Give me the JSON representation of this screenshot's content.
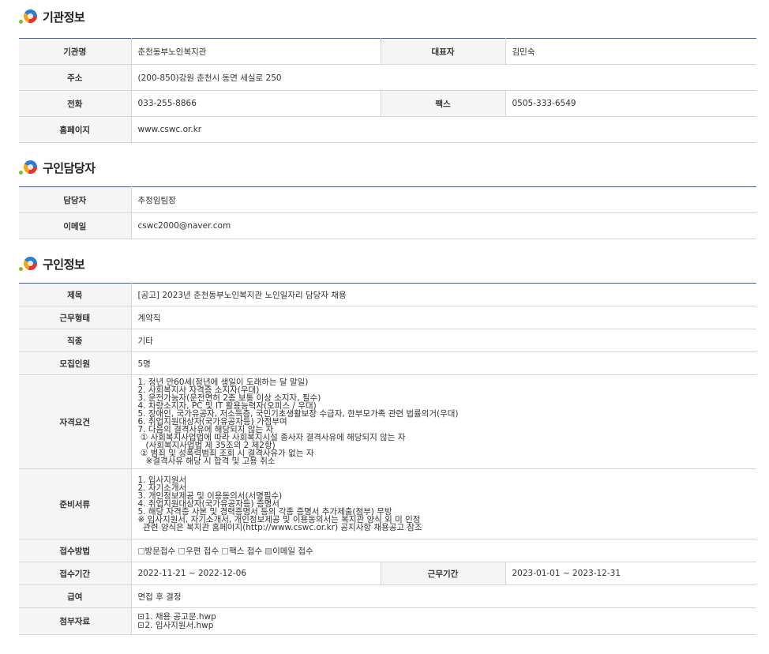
{
  "sections": {
    "agency": {
      "title": "기관정보"
    },
    "manager": {
      "title": "구인담당자"
    },
    "job": {
      "title": "구인정보"
    }
  },
  "agency": {
    "name_label": "기관명",
    "name": "춘천동부노인복지관",
    "rep_label": "대표자",
    "rep": "김민숙",
    "addr_label": "주소",
    "addr": "(200-850)강원 춘천시 동면 세실로 250",
    "phone_label": "전화",
    "phone": "033-255-8866",
    "fax_label": "팩스",
    "fax": "0505-333-6549",
    "web_label": "홈페이지",
    "web": "www.cswc.or.kr"
  },
  "manager": {
    "person_label": "담당자",
    "person": "추정임팀장",
    "email_label": "이메일",
    "email": "cswc2000@naver.com"
  },
  "job": {
    "title_label": "제목",
    "title": "[공고] 2023년 춘천동부노인복지관 노인일자리 담당자 채용",
    "type_label": "근무형태",
    "type": "계약직",
    "category_label": "직종",
    "category": "기타",
    "count_label": "모집인원",
    "count": "5명",
    "qual_label": "자격요건",
    "qualifications": "1. 정년 만60세(정년에 생일이 도래하는 달 말일)\n2. 사회복지사 자격증 소지자(우대)\n3. 운전가능자(운전면허 2종 보통 이상 소지자, 필수)\n4. 차량소지자, PC 및 IT 활용능력자(오피스 / 우대)\n5. 장애인, 국가유공자, 저소득층, 국민기초생활보장 수급자, 한부모가족 관련 법률의거(우대)\n6. 취업지원대상자(국가유공자등) 가점부여\n7. 다음의 결격사유에 해당되지 않는 자\n ① 사회복지사업법에 따라 사회복지시설 종사자 결격사유에 해당되지 않는 자\n   (사회복지사업법 제 35조의 2 제2항)\n ② 범죄 및 성폭력범죄 조회 시 결격사유가 없는 자\n   ※결격사유 해당 시 합격 및 고용 취소",
    "docs_label": "준비서류",
    "documents": "1. 입사지원서\n2. 자기소개서\n3. 개인정보제공 및 이용동의서(서명필수)\n4. 취업지원대상자(국가유공자등) 증명서\n5. 해당 자격증 사본 및 경력증명서 등의 각종 증명서 추가제출(첨부) 무방\n※ 입사지원서, 자기소개서, 개인정보제공 및 이용동의서는 복지관 양식 외 미 인정\n  관련 양식은 복지관 홈페이지(http://www.cswc.or.kr) 공지사항 채용공고 참조",
    "method_label": "접수방법",
    "methods": [
      {
        "label": "방문접수",
        "checked": false
      },
      {
        "label": "우편 접수",
        "checked": false
      },
      {
        "label": "팩스 접수",
        "checked": false
      },
      {
        "label": "이메일 접수",
        "checked": true
      }
    ],
    "period_label": "접수기간",
    "period": "2022-11-21 ~ 2022-12-06",
    "work_period_label": "근무기간",
    "work_period": "2023-01-01 ~ 2023-12-31",
    "salary_label": "급여",
    "salary": "면접 후 결정",
    "attach_label": "첨부자료",
    "attachments": [
      "1. 채용 공고문.hwp",
      "2. 입사지원서.hwp"
    ]
  }
}
